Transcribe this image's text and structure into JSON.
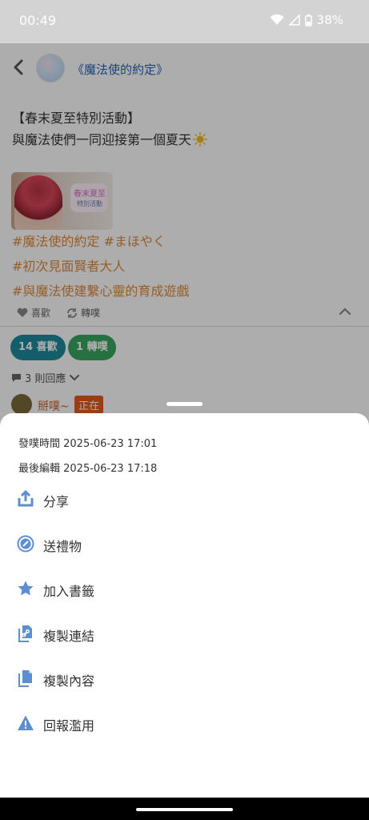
{
  "status_bar": {
    "time": "00:49",
    "battery": "38%"
  },
  "header": {
    "board_title": "《魔法使的約定》"
  },
  "post": {
    "line1": "【春末夏至特別活動】",
    "line2": "與魔法使們一同迎接第一個夏天",
    "image": {
      "logo_line1": "春末夏至",
      "logo_line2": "特別活動"
    },
    "tags": [
      "#魔法使的約定 #まほやく",
      "#初次見面賢者大人",
      "#與魔法使建繫心靈的育成遊戲"
    ],
    "actions": {
      "like": "喜歡",
      "share": "轉噗"
    },
    "counts": {
      "likes": "14 喜歡",
      "shares": "1 轉噗"
    },
    "comments_toggle": "3 則回應",
    "first_comment": {
      "name": "掰噗~",
      "status": "正在"
    }
  },
  "sheet": {
    "posted_time": "發噗時間 2025-06-23 17:01",
    "edited_time": "最後編輯 2025-06-23 17:18",
    "menu": [
      {
        "label": "分享",
        "icon": "share-icon"
      },
      {
        "label": "送禮物",
        "icon": "gift-icon"
      },
      {
        "label": "加入書籤",
        "icon": "star-icon"
      },
      {
        "label": "複製連結",
        "icon": "copy-link-icon"
      },
      {
        "label": "複製內容",
        "icon": "copy-content-icon"
      },
      {
        "label": "回報濫用",
        "icon": "warning-icon"
      }
    ]
  },
  "colors": {
    "accent": "#5b8fd1",
    "board_title": "#2a62b5",
    "tag": "#e08a3b",
    "likes_pill": "#1e8a9d",
    "shares_pill": "#3aa560"
  }
}
